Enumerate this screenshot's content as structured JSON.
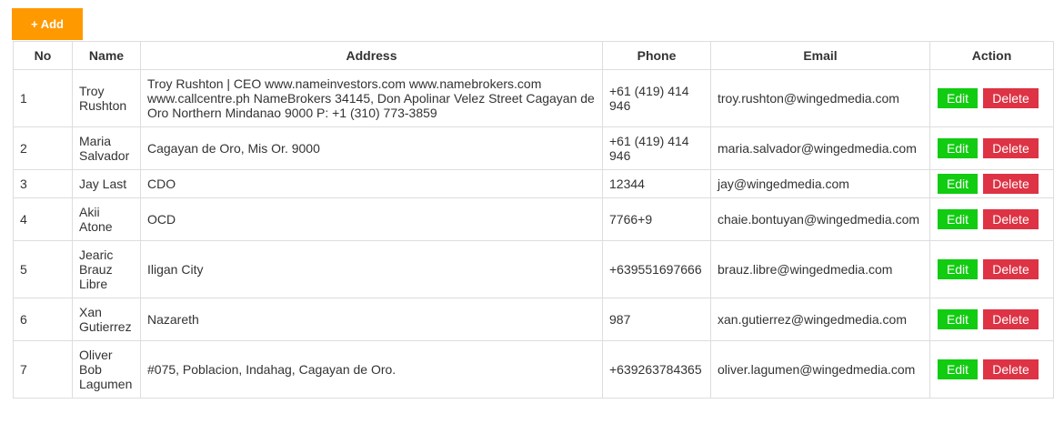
{
  "toolbar": {
    "add_label": "+ Add"
  },
  "table": {
    "headers": {
      "no": "No",
      "name": "Name",
      "address": "Address",
      "phone": "Phone",
      "email": "Email",
      "action": "Action"
    },
    "edit_label": "Edit",
    "delete_label": "Delete",
    "rows": [
      {
        "no": "1",
        "name": "Troy Rushton",
        "address": "Troy Rushton | CEO www.nameinvestors.com www.namebrokers.com www.callcentre.ph NameBrokers 34145, Don Apolinar Velez Street Cagayan de Oro Northern Mindanao 9000 P: +1 (310) 773-3859",
        "phone": "+61 (419) 414 946",
        "email": "troy.rushton@wingedmedia.com"
      },
      {
        "no": "2",
        "name": "Maria Salvador",
        "address": "Cagayan de Oro, Mis Or. 9000",
        "phone": "+61 (419) 414 946",
        "email": "maria.salvador@wingedmedia.com"
      },
      {
        "no": "3",
        "name": "Jay Last",
        "address": "CDO",
        "phone": "12344",
        "email": "jay@wingedmedia.com"
      },
      {
        "no": "4",
        "name": "Akii Atone",
        "address": "OCD",
        "phone": "7766+9",
        "email": "chaie.bontuyan@wingedmedia.com"
      },
      {
        "no": "5",
        "name": "Jearic Brauz Libre",
        "address": "Iligan City",
        "phone": "+639551697666",
        "email": "brauz.libre@wingedmedia.com"
      },
      {
        "no": "6",
        "name": "Xan Gutierrez",
        "address": "Nazareth",
        "phone": "987",
        "email": "xan.gutierrez@wingedmedia.com"
      },
      {
        "no": "7",
        "name": "Oliver Bob Lagumen",
        "address": "#075, Poblacion, Indahag, Cagayan de Oro.",
        "phone": "+639263784365",
        "email": "oliver.lagumen@wingedmedia.com"
      }
    ]
  },
  "colors": {
    "add_button": "#ff9900",
    "edit_button": "#11cc11",
    "delete_button": "#dd3344",
    "border": "#dddddd"
  }
}
